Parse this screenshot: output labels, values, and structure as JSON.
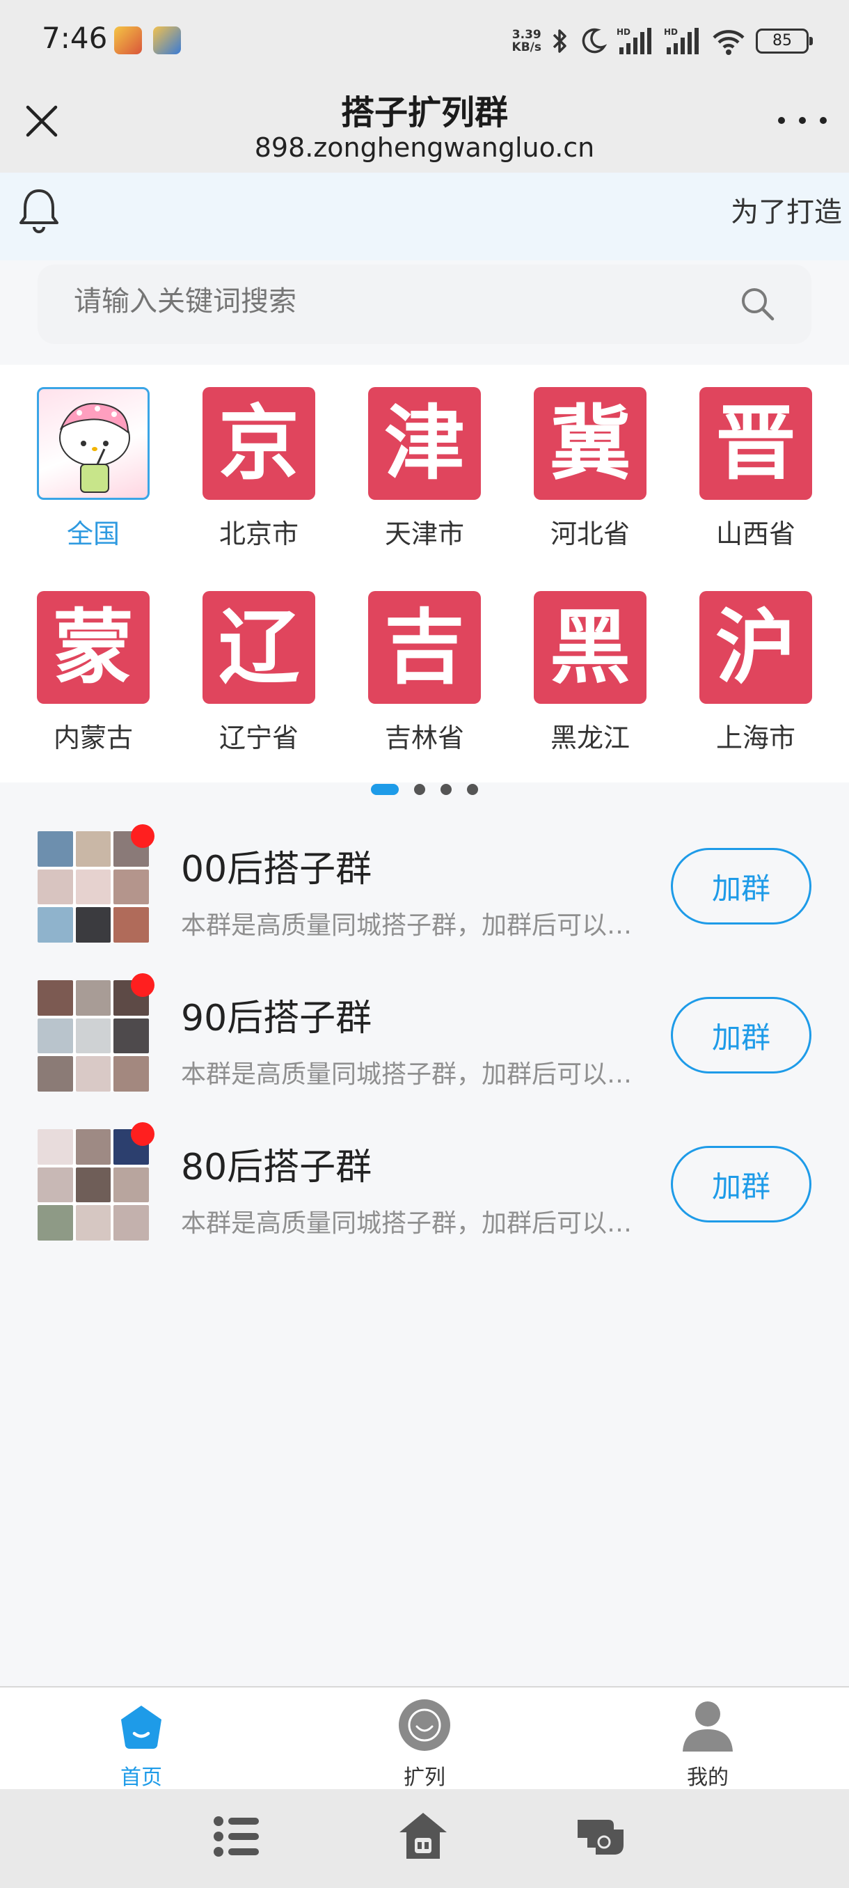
{
  "status_bar": {
    "time": "7:46",
    "net_speed_value": "3.39",
    "net_speed_unit": "KB/s",
    "battery": "85",
    "icons": [
      "game-app-icon",
      "blue-app-icon",
      "bluetooth-icon",
      "moon-icon",
      "signal-hd-icon",
      "signal-hd-icon",
      "wifi-icon",
      "battery-icon"
    ]
  },
  "titlebar": {
    "title": "搭子扩列群",
    "url": "898.zonghengwangluo.cn"
  },
  "notice": {
    "text": "为了打造"
  },
  "search": {
    "placeholder": "请输入关键词搜索"
  },
  "regions": [
    {
      "label": "全国",
      "glyph": "",
      "active": true
    },
    {
      "label": "北京市",
      "glyph": "京"
    },
    {
      "label": "天津市",
      "glyph": "津"
    },
    {
      "label": "河北省",
      "glyph": "冀"
    },
    {
      "label": "山西省",
      "glyph": "晋"
    },
    {
      "label": "内蒙古",
      "glyph": "蒙"
    },
    {
      "label": "辽宁省",
      "glyph": "辽"
    },
    {
      "label": "吉林省",
      "glyph": "吉"
    },
    {
      "label": "黑龙江",
      "glyph": "黑"
    },
    {
      "label": "上海市",
      "glyph": "沪"
    }
  ],
  "pager": {
    "pages": 4,
    "active": 0
  },
  "groups": [
    {
      "name": "00后搭子群",
      "desc": "本群是高质量同城搭子群，加群后可以…",
      "button": "加群"
    },
    {
      "name": "90后搭子群",
      "desc": "本群是高质量同城搭子群，加群后可以…",
      "button": "加群"
    },
    {
      "name": "80后搭子群",
      "desc": "本群是高质量同城搭子群，加群后可以…",
      "button": "加群"
    }
  ],
  "tabbar": {
    "home": "首页",
    "expand": "扩列",
    "mine": "我的"
  },
  "colors": {
    "accent": "#1e9be8",
    "region_badge": "#e0455d",
    "unread_dot": "#ff1f1f"
  }
}
